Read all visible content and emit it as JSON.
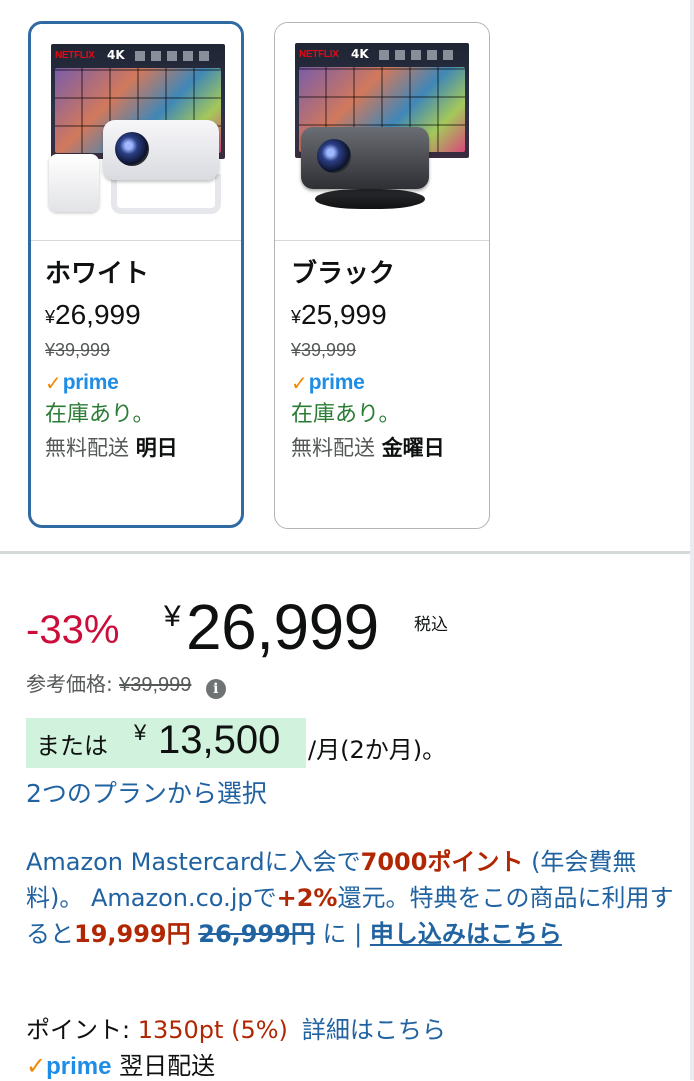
{
  "variants": [
    {
      "name": "ホワイト",
      "price_yen": "¥",
      "price": "26,999",
      "list_price": "¥39,999",
      "prime_label": "prime",
      "stock": "在庫あり。",
      "shipping_label": "無料配送",
      "shipping_day": "明日",
      "selected": true
    },
    {
      "name": "ブラック",
      "price_yen": "¥",
      "price": "25,999",
      "list_price": "¥39,999",
      "prime_label": "prime",
      "stock": "在庫あり。",
      "shipping_label": "無料配送",
      "shipping_day": "金曜日",
      "selected": false
    }
  ],
  "product_image_text": {
    "brand": "NETFLIX",
    "resolution": "4K"
  },
  "pricing": {
    "discount": "-33%",
    "yen": "¥",
    "price": "26,999",
    "tax_label": "税込",
    "reference_label": "参考価格:",
    "reference_price": "¥39,999",
    "info_icon": "i"
  },
  "installment": {
    "prefix": "または",
    "yen": "¥",
    "amount": "13,500",
    "per": "/月(2か月)。",
    "plans_link": "2つのプランから選択"
  },
  "promo": {
    "part1": "Amazon Mastercardに入会で",
    "points": "7000ポイント",
    "part2": " (年会費無料)。 Amazon.co.jpで",
    "bonus": "+2%",
    "part3": "還元。特典をこの商品に利用すると",
    "discounted_price": "19,999円",
    "original_price": "26,999円",
    "part4": " に | ",
    "apply_link": "申し込みはこちら"
  },
  "points": {
    "label": "ポイント: ",
    "value": "1350pt",
    "percent": "(5%)",
    "detail_link": "詳細はこちら"
  },
  "delivery": {
    "prime_label": "prime",
    "text": "翌日配送"
  },
  "colors": {
    "selected_border": "#2f6aa3",
    "discount_red": "#cc0c39",
    "stock_green": "#2a7c34",
    "link_blue": "#2162a1",
    "prime_blue": "#1f8ce6",
    "prime_orange": "#f08804",
    "installment_bg": "#d1f2dc",
    "promo_red": "#b12704"
  }
}
